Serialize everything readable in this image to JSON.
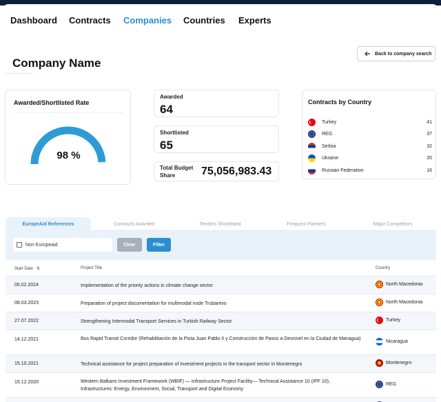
{
  "nav": {
    "items": [
      {
        "label": "Dashboard",
        "active": false
      },
      {
        "label": "Contracts",
        "active": false
      },
      {
        "label": "Companies",
        "active": true
      },
      {
        "label": "Countries",
        "active": false
      },
      {
        "label": "Experts",
        "active": false
      }
    ]
  },
  "header": {
    "title": "Company Name",
    "back_label": "Back to company search"
  },
  "gauge": {
    "title": "Awarded/Shortlisted Rate",
    "value_label": "98 %",
    "fraction": 0.98,
    "fill_color": "#2e9bd6",
    "track_color": "#e8eef4"
  },
  "stats": {
    "awarded_label": "Awarded",
    "awarded_value": "64",
    "shortlisted_label": "Shortlisted",
    "shortlisted_value": "65",
    "budget_label_line1": "Total Budget",
    "budget_label_line2": "Share",
    "budget_value": "75,056,983.43"
  },
  "contracts_by_country": {
    "title": "Contracts by Country",
    "rows": [
      {
        "name": "Turkey",
        "count": "41",
        "flag": "turkey-flag-icon"
      },
      {
        "name": "REG",
        "count": "37",
        "flag": "eu-flag-icon"
      },
      {
        "name": "Serbia",
        "count": "32",
        "flag": "serbia-flag-icon"
      },
      {
        "name": "Ukraine",
        "count": "20",
        "flag": "ukraine-flag-icon"
      },
      {
        "name": "Russian Federation",
        "count": "16",
        "flag": "russia-flag-icon"
      }
    ]
  },
  "tabs": [
    {
      "label": "EuropeAid References",
      "active": true
    },
    {
      "label": "Contracts Awarded",
      "active": false
    },
    {
      "label": "Tenders Shortlisted",
      "active": false
    },
    {
      "label": "Frequent Partners",
      "active": false
    },
    {
      "label": "Major Competitors",
      "active": false
    }
  ],
  "filters": {
    "checkbox_label": "Non Europeaid",
    "clear_label": "Clear",
    "filter_label": "Filter"
  },
  "table": {
    "headers": {
      "date": "Start Date",
      "title": "Project Title",
      "country": "Country"
    },
    "rows": [
      {
        "date": "05.02.2024",
        "title": "Implementation of the priority actions in climate change sector",
        "country": "North Macedonia",
        "flag": "north-macedonia-flag-icon"
      },
      {
        "date": "08.03.2023",
        "title": "Preparation of project documentation for multimodal node Trubarevo",
        "country": "North Macedonia",
        "flag": "north-macedonia-flag-icon"
      },
      {
        "date": "27.07.2022",
        "title": "Strengthening Intermodal Transport Services in Turkish Railway Sector",
        "country": "Turkey",
        "flag": "turkey-flag-icon"
      },
      {
        "date": "14.12.2021",
        "title": "Bus Rapid Transit Corridor (Rehabilitación de la Pista Juan Pablo II y Construcción de Pasos a Desnivel en la Ciudad de Managua)",
        "country": "Nicaragua",
        "flag": "nicaragua-flag-icon"
      },
      {
        "date": "15.10.2021",
        "title": "Technical assistance for project preparation of Investment projects in the transport sector in Montenegro",
        "country": "Montenegro",
        "flag": "montenegro-flag-icon"
      },
      {
        "date": "15.12.2020",
        "title": "Western Balkans Investment Framework (WBIF) — Infrastructure Project Facility— Technical Assistance 10 (IPF 10), Infrastructures: Energy, Environment, Social, Transport and Digital Economy",
        "country": "REG",
        "flag": "eu-flag-icon"
      }
    ]
  }
}
